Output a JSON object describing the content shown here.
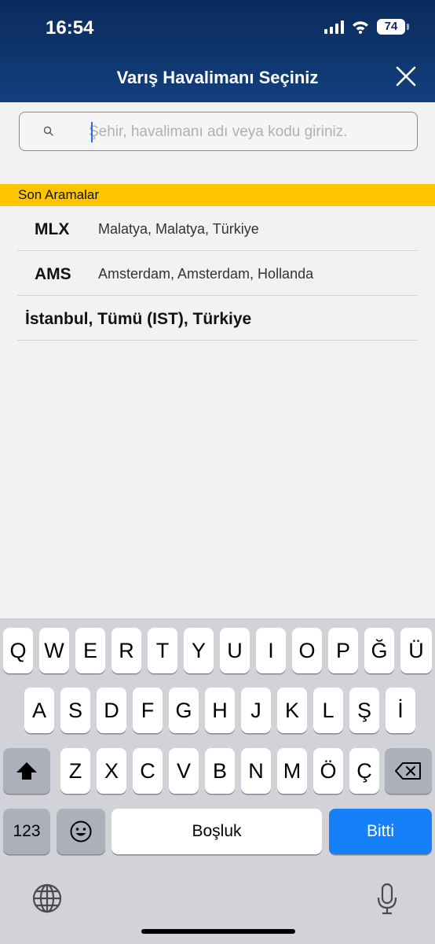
{
  "status_bar": {
    "time": "16:54",
    "battery": "74"
  },
  "header": {
    "title": "Varış Havalimanı Seçiniz",
    "close_icon": "close-icon"
  },
  "search": {
    "placeholder": "Şehir, havalimanı adı veya kodu giriniz.",
    "value": ""
  },
  "recent": {
    "title": "Son Aramalar",
    "items": [
      {
        "code": "MLX",
        "name": "Malatya, Malatya, Türkiye"
      },
      {
        "code": "AMS",
        "name": "Amsterdam, Amsterdam, Hollanda"
      },
      {
        "city": "İstanbul, Tümü (IST), Türkiye"
      }
    ]
  },
  "keyboard": {
    "row1": [
      "Q",
      "W",
      "E",
      "R",
      "T",
      "Y",
      "U",
      "I",
      "O",
      "P",
      "Ğ",
      "Ü"
    ],
    "row2": [
      "A",
      "S",
      "D",
      "F",
      "G",
      "H",
      "J",
      "K",
      "L",
      "Ş",
      "İ"
    ],
    "row3": [
      "Z",
      "X",
      "C",
      "V",
      "B",
      "N",
      "M",
      "Ö",
      "Ç"
    ],
    "numbers": "123",
    "space": "Boşluk",
    "done": "Bitti"
  },
  "colors": {
    "header": "#0b2a5c",
    "accent": "#ffc600",
    "done": "#1580f8"
  }
}
